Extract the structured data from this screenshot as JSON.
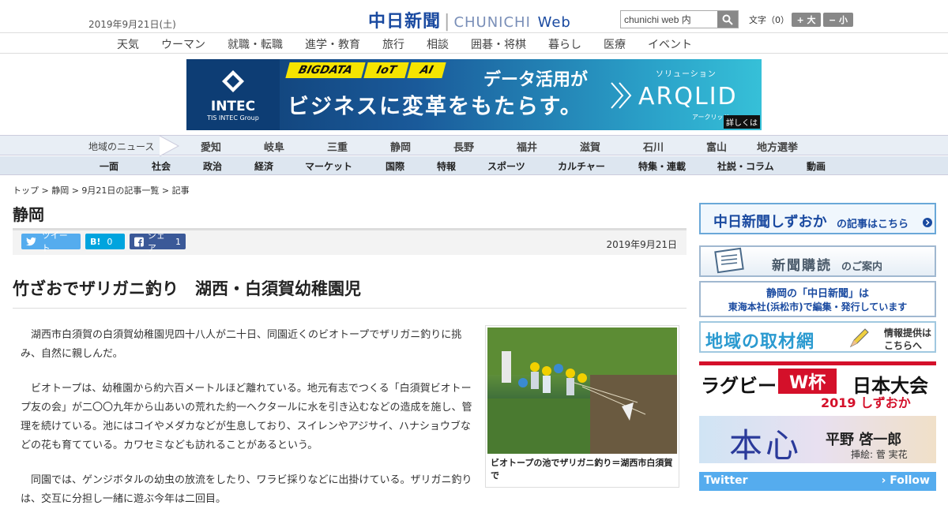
{
  "header": {
    "date": "2019年9月21日(土)",
    "logo_jp": "中日新聞",
    "logo_en": "CHUNICHI",
    "logo_web": "Web",
    "search_value": "chunichi web 内",
    "font_label": "文字（0）",
    "font_up": "+ 大",
    "font_down": "− 小"
  },
  "nav1": [
    "天気",
    "ウーマン",
    "就職・転職",
    "進学・教育",
    "旅行",
    "相談",
    "囲碁・将棋",
    "暮らし",
    "医療",
    "イベント"
  ],
  "ad": {
    "brand": "INTEC",
    "brand_sub": "TIS INTEC Group",
    "tags": [
      "BIGDATA",
      "IoT",
      "AI"
    ],
    "line1": "データ活用が",
    "line2": "ビジネスに変革をもたらす。",
    "solution": "ソリューション",
    "product": "ARQLID",
    "product_kana": "アークリッド",
    "more": "詳しくは"
  },
  "region": {
    "label": "地域のニュース",
    "items": [
      "愛知",
      "岐阜",
      "三重",
      "静岡",
      "長野",
      "福井",
      "滋賀",
      "石川",
      "富山",
      "地方選挙"
    ]
  },
  "categories": [
    "一面",
    "社会",
    "政治",
    "経済",
    "マーケット",
    "国際",
    "特報",
    "スポーツ",
    "カルチャー",
    "特集・連載",
    "社説・コラム",
    "動画"
  ],
  "breadcrumb": "トップ > 静岡 > 9月21日の記事一覧 > 記事",
  "section_title": "静岡",
  "share": {
    "tweet": "ツイート",
    "hatena": "B!",
    "hatena_count": "0",
    "fb": "シェア",
    "fb_count": "1"
  },
  "article": {
    "date": "2019年9月21日",
    "headline": "竹ざおでザリガニ釣り　湖西・白須賀幼稚園児",
    "p1": "湖西市白須賀の白須賀幼稚園児四十八人が二十日、同園近くのビオトープでザリガニ釣りに挑み、自然に親しんだ。",
    "p2": "ビオトープは、幼稚園から約六百メートルほど離れている。地元有志でつくる「白須賀ビオトープ友の会」が二〇〇九年から山あいの荒れた約一ヘクタールに水を引き込むなどの造成を施し、管理を続けている。池にはコイやメダカなどが生息しており、スイレンやアジサイ、ハナショウブなどの花も育てている。カワセミなども訪れることがあるという。",
    "p3": "同園では、ゲンジボタルの幼虫の放流をしたり、ワラビ採りなどに出掛けている。ザリガニ釣りは、交互に分担し一緒に遊ぶ今年は二回目。",
    "photo_caption": "ビオトープの池でザリガニ釣り＝湖西市白須賀で"
  },
  "sidebar": {
    "b1_main": "中日新聞しずおか",
    "b1_sub": "の記事はこちら",
    "b2_main": "新聞購読",
    "b2_sub": "のご案内",
    "b3_line1": "静岡の「中日新聞」は",
    "b3_line2": "東海本社(浜松市)で編集・発行しています",
    "b4_main": "地域の取材網",
    "b4_sub1": "情報提供は",
    "b4_sub2": "こちらへ",
    "b5_a": "ラグビー",
    "b5_b": "W杯",
    "b5_c": "日本大会",
    "b5_d": "2019 しずおか",
    "b6_main": "本心",
    "b6_author": "平野 啓一郎",
    "b6_illus": "挿絵: 菅 実花",
    "twitter": "Twitter",
    "follow": "› Follow"
  },
  "colors": {
    "brand_blue": "#1a4aa0",
    "twitter": "#55acee",
    "facebook": "#3b5998",
    "hatena": "#00a4de",
    "red": "#d4102a"
  }
}
